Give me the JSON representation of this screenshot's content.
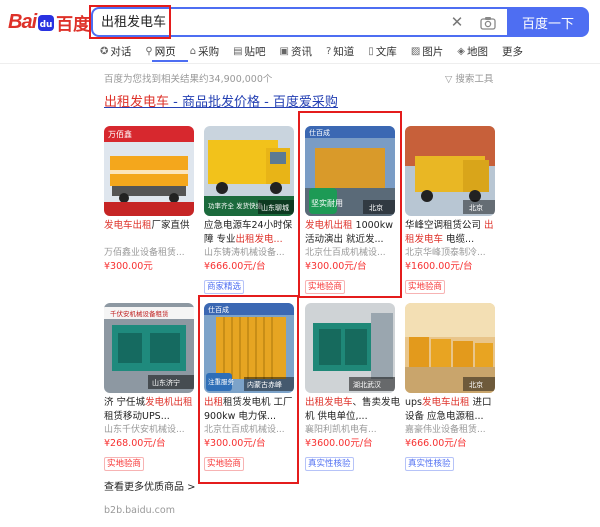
{
  "brand": {
    "logo_text_left": "Bai",
    "logo_text_right": "百度"
  },
  "search": {
    "query": "出租发电车",
    "button_label": "百度一下"
  },
  "tabs": [
    {
      "label": "对话",
      "icon": "chat-icon"
    },
    {
      "label": "网页",
      "icon": "search-icon",
      "active": true
    },
    {
      "label": "采购",
      "icon": "shop-icon"
    },
    {
      "label": "贴吧",
      "icon": "tieba-icon"
    },
    {
      "label": "资讯",
      "icon": "news-icon"
    },
    {
      "label": "知道",
      "icon": "question-icon"
    },
    {
      "label": "文库",
      "icon": "doc-icon"
    },
    {
      "label": "图片",
      "icon": "image-icon"
    },
    {
      "label": "地图",
      "icon": "map-icon"
    },
    {
      "label": "更多",
      "icon": ""
    }
  ],
  "results": {
    "count_text": "百度为您找到相关结果约34,900,000个",
    "tools_label": "搜索工具",
    "title_keyword": "出租发电车",
    "title_rest": " - 商品批发价格 - 百度爱采购",
    "more_label": "查看更多优质商品 >",
    "source": "b2b.baidu.com"
  },
  "cards": [
    {
      "title_pre": "",
      "title_kw": "发电车出租",
      "title_post": "厂家直供",
      "seller": "万佰鑫业设备租赁...",
      "price": "¥300.00元",
      "badge": "",
      "img_tag": "万佰鑫",
      "img_sub": "",
      "img_loc": ""
    },
    {
      "title_pre": "应急电源车24小时保障 专业",
      "title_kw": "出租发电...",
      "title_post": "",
      "seller": "山东铸涛机械设备...",
      "price": "¥666.00元/台",
      "badge": "商家精选",
      "badge_color": "blue",
      "img_tag": "",
      "img_sub": "功率齐全 发货快捷",
      "img_loc": "山东聊城"
    },
    {
      "title_pre": "",
      "title_kw": "发电机出租",
      "title_post": " 1000kw 活动演出 就近发...",
      "seller": "北京仕百成机械设...",
      "price": "¥300.00元/台",
      "badge": "实地验商",
      "badge_color": "red",
      "img_tag": "仕百成",
      "img_sub": "坚实耐用",
      "img_loc": "北京"
    },
    {
      "title_pre": "华峰空调租赁公司 ",
      "title_kw": "出租发电车",
      "title_post": " 电缆...",
      "seller": "北京华峰顶泰制冷...",
      "price": "¥1600.00元/台",
      "badge": "实地验商",
      "badge_color": "red",
      "img_tag": "",
      "img_sub": "",
      "img_loc": "北京"
    },
    {
      "title_pre": "济 宁任城",
      "title_kw": "发电机出租",
      "title_post": " 租赁移动UPS...",
      "seller": "山东千伏安机械设...",
      "price": "¥268.00元/台",
      "badge": "实地验商",
      "badge_color": "red",
      "img_tag": "千伏安机械设备租赁",
      "img_sub": "",
      "img_loc": "山东济宁"
    },
    {
      "title_pre": "",
      "title_kw": "出租",
      "title_post": "租赁发电机 工厂 900kw 电力保...",
      "seller": "北京仕百成机械设...",
      "price": "¥300.00元/台",
      "badge": "实地验商",
      "badge_color": "red",
      "img_tag": "仕百成",
      "img_sub": "注重服务",
      "img_loc": "内蒙古赤峰"
    },
    {
      "title_pre": "",
      "title_kw": "出租发电车",
      "title_post": "、售卖发电机 供电单位,...",
      "seller": "襄阳利凯机电有...",
      "price": "¥3600.00元/台",
      "badge": "真实性核验",
      "badge_color": "blue",
      "img_tag": "",
      "img_sub": "",
      "img_loc": "湖北武汉"
    },
    {
      "title_pre": "ups",
      "title_kw": "发电车出租",
      "title_post": " 进口设备 应急电源租...",
      "seller": "嘉豪伟业设备租赁...",
      "price": "¥666.00元/台",
      "badge": "真实性核验",
      "badge_color": "blue",
      "img_tag": "",
      "img_sub": "",
      "img_loc": "北京"
    }
  ],
  "colors": {
    "accent": "#4e6ef2",
    "keyword": "#de3129",
    "price": "#f73131",
    "highlight_box": "#e41c1c"
  }
}
